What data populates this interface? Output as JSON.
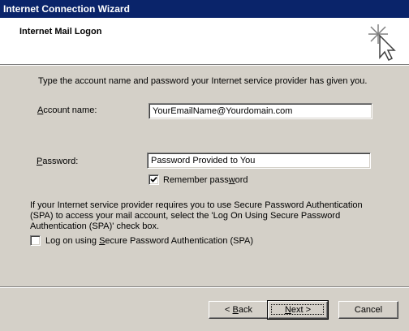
{
  "window": {
    "title": "Internet Connection Wizard"
  },
  "header": {
    "title": "Internet Mail Logon",
    "icon": "wizard-wand-icon"
  },
  "content": {
    "intro": "Type the account name and password your Internet service provider has given you.",
    "account_label_pre": "",
    "account_label_key": "A",
    "account_label_post": "ccount name:",
    "account_value": "YourEmailName@Yourdomain.com",
    "password_label_pre": "",
    "password_label_key": "P",
    "password_label_post": "assword:",
    "password_value": "Password Provided to You",
    "remember_pre": "Remember pass",
    "remember_key": "w",
    "remember_post": "ord",
    "remember_checked": true,
    "spa_note_line1": "If your Internet service provider requires you to use Secure Password Authentication",
    "spa_note_line2": "(SPA) to access your mail account, select the 'Log On Using Secure Password",
    "spa_note_line3": "Authentication (SPA)' check box.",
    "spa_pre": "Log on using ",
    "spa_key": "S",
    "spa_post": "ecure Password Authentication (SPA)",
    "spa_checked": false
  },
  "buttons": {
    "back_pre": "< ",
    "back_key": "B",
    "back_post": "ack",
    "next_pre": "",
    "next_key": "N",
    "next_post": "ext >",
    "cancel": "Cancel"
  },
  "colors": {
    "titlebar": "#0a246a",
    "face": "#d4d0c8"
  }
}
